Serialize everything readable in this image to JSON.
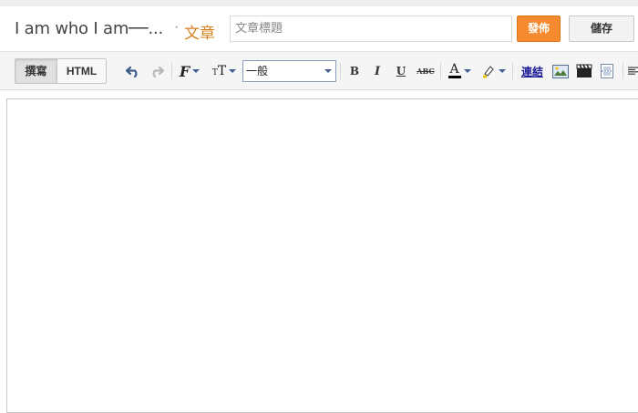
{
  "header": {
    "blog_title": "I am who I am──...",
    "separator": "·",
    "post_kind": "文章",
    "title_placeholder": "文章標題",
    "publish_label": "發佈",
    "save_label": "儲存"
  },
  "toolbar": {
    "compose_label": "撰寫",
    "html_label": "HTML",
    "format_value": "一般",
    "link_label": "連結",
    "text_color_swatch": "#000000",
    "highlight_swatch": "#f6e58d"
  },
  "colors": {
    "accent": "#f58a2f",
    "post_kind": "#d4821e"
  },
  "icons": [
    "undo-icon",
    "redo-icon",
    "font-icon",
    "font-size-icon",
    "bold-icon",
    "italic-icon",
    "underline-icon",
    "strikethrough-icon",
    "text-color-icon",
    "highlight-icon",
    "image-icon",
    "video-icon",
    "jump-break-icon",
    "align-icon"
  ]
}
